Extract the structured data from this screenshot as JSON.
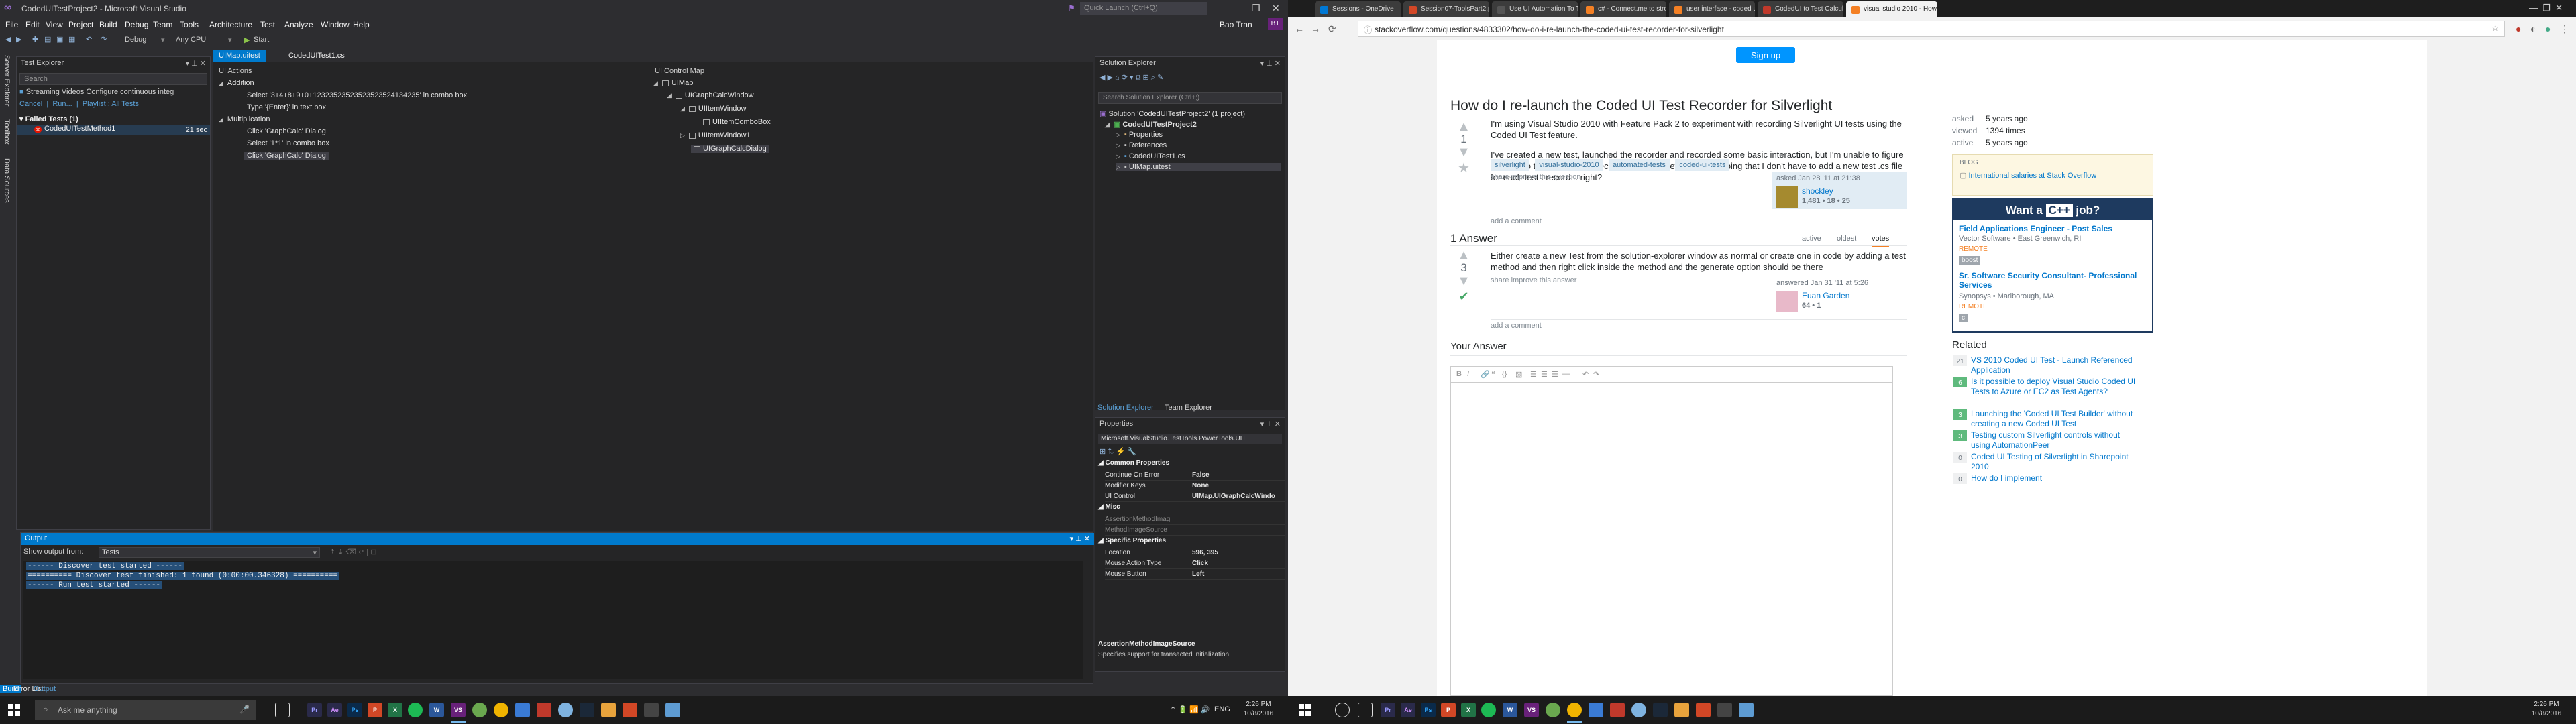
{
  "vs": {
    "title": "CodedUITestProject2 - Microsoft Visual Studio",
    "quick_launch": "Quick Launch (Ctrl+Q)",
    "user": "Bao Tran",
    "user_initials": "BT",
    "menu": [
      "File",
      "Edit",
      "View",
      "Project",
      "Build",
      "Debug",
      "Team",
      "Tools",
      "Architecture",
      "Test",
      "Analyze",
      "Window",
      "Help"
    ],
    "toolbar": {
      "config": "Debug",
      "platform": "Any CPU",
      "start": "Start"
    },
    "side_tabs": [
      "Server Explorer",
      "Toolbox",
      "Data Sources"
    ],
    "test_explorer": {
      "title": "Test Explorer",
      "search": "Search",
      "banner": "Streaming Videos Configure continuous integ",
      "links": [
        "Cancel",
        "Run...",
        "Playlist : All Tests"
      ],
      "group": "Failed Tests (1)",
      "test": "CodedUITestMethod1",
      "duration": "21 sec"
    },
    "doc_tabs": [
      "UIMap.uitest",
      "CodedUITest1.cs"
    ],
    "ui_actions": {
      "title": "UI Actions",
      "lines": [
        "Addition",
        "Select '3+4+8+9+0+12323523523523523524134235' in combo box",
        "Type '{Enter}' in text box",
        "Multiplication",
        "Click 'GraphCalc' Dialog",
        "Select '1*1' in combo box",
        "Click 'GraphCalc' Dialog"
      ]
    },
    "ui_control_map": {
      "title": "UI Control Map",
      "nodes": [
        "UIMap",
        "UIGraphCalcWindow",
        "UIItemWindow",
        "UIItemComboBox",
        "UIItemWindow1",
        "UIGraphCalcDialog"
      ]
    },
    "solution_explorer": {
      "title": "Solution Explorer",
      "search": "Search Solution Explorer (Ctrl+;)",
      "items": [
        "Solution 'CodedUITestProject2' (1 project)",
        "CodedUITestProject2",
        "Properties",
        "References",
        "CodedUITest1.cs",
        "UIMap.uitest"
      ],
      "tabs": [
        "Solution Explorer",
        "Team Explorer"
      ]
    },
    "properties": {
      "title": "Properties",
      "selector": "Microsoft.VisualStudio.TestTools.PowerTools.UIT",
      "cat1": "Common Properties",
      "rows1": [
        {
          "k": "Continue On Error",
          "v": "False"
        },
        {
          "k": "Modifier Keys",
          "v": "None"
        },
        {
          "k": "UI Control",
          "v": "UIMap.UIGraphCalcWindo"
        }
      ],
      "cat2": "Misc",
      "rows2": [
        {
          "k": "AssertionMethodImag",
          "v": ""
        },
        {
          "k": "MethodImageSource",
          "v": ""
        }
      ],
      "cat3": "Specific Properties",
      "rows3": [
        {
          "k": "Location",
          "v": "596, 395"
        },
        {
          "k": "Mouse Action Type",
          "v": "Click"
        },
        {
          "k": "Mouse Button",
          "v": "Left"
        }
      ],
      "desc_title": "AssertionMethodImageSource",
      "desc": "Specifies support for transacted initialization."
    },
    "output": {
      "title": "Output",
      "show_from_label": "Show output from:",
      "source": "Tests",
      "lines": [
        "------ Discover test started ------",
        "========== Discover test finished: 1 found (0:00:00.346328) ==========",
        "------ Run test started ------"
      ]
    },
    "status": [
      "Build",
      "Error List",
      "Output"
    ]
  },
  "left_taskbar": {
    "search": "Ask me anything",
    "time": "2:26 PM",
    "date": "10/8/2016",
    "lang": "ENG"
  },
  "chrome": {
    "tabs": [
      "Sessions - OneDrive",
      "Session07-ToolsPart2.pp",
      "Use UI Automation To T",
      "c# - Connect.me to stro",
      "user interface - coded u",
      "CodedUI to Test Calcula",
      "visual studio 2010 - How"
    ],
    "url": "stackoverflow.com/questions/4833302/how-do-i-re-launch-the-coded-ui-test-recorder-for-silverlight",
    "signup": "Sign up",
    "question": {
      "title": "How do I re-launch the Coded UI Test Recorder for Silverlight",
      "votes": "1",
      "p1": "I'm using Visual Studio 2010 with Feature Pack 2 to experiment with recording Silverlight UI tests using the Coded UI Test feature.",
      "p2": "I've created a new test, launched the recorder and recorded some basic interaction, but I'm unable to figure out how to to re-launch the recorder to add a new test. I'm hoping that I don't have to add a new test .cs file for each test I record... right?",
      "tags": [
        "silverlight",
        "visual-studio-2010",
        "automated-tests",
        "coded-ui-tests"
      ],
      "actions": "share  improve this question",
      "asked": "asked Jan 28 '11 at 21:38",
      "user": "shockley",
      "rep": "1,481 • 18 • 25",
      "comment": "add a comment"
    },
    "answers_header": "1 Answer",
    "sort": [
      "active",
      "oldest",
      "votes"
    ],
    "answer": {
      "votes": "3",
      "text": "Either create a new Test from the solution-explorer window as normal or create one in code by adding a test method and then right click inside the method and the generate option should be there",
      "actions": "share  improve this answer",
      "answered": "answered Jan 31 '11 at 5:26",
      "user": "Euan Garden",
      "rep": "64 • 1",
      "comment": "add a comment"
    },
    "your_answer": "Your Answer",
    "meta": [
      {
        "k": "asked",
        "v": "5 years ago"
      },
      {
        "k": "viewed",
        "v": "1394 times"
      },
      {
        "k": "active",
        "v": "5 years ago"
      }
    ],
    "blog": {
      "title": "BLOG",
      "item": "International salaries at Stack Overflow"
    },
    "job": {
      "head": "Want a",
      "head_tag": "C++",
      "head_end": "job?",
      "jobs": [
        {
          "t": "Field Applications Engineer - Post Sales",
          "co": "Vector Software  •  East Greenwich, RI",
          "r": "REMOTE",
          "tag": "boost"
        },
        {
          "t": "Sr. Software Security Consultant- Professional Services",
          "co": "Synopsys  •  Marlborough, MA",
          "r": "REMOTE",
          "tag": "c"
        }
      ]
    },
    "related_title": "Related",
    "related": [
      {
        "c": "21",
        "t": "VS 2010 Coded UI Test - Launch Referenced Application",
        "g": false
      },
      {
        "c": "6",
        "t": "Is it possible to deploy Visual Studio Coded UI Tests to Azure or EC2 as Test Agents?",
        "g": true
      },
      {
        "c": "3",
        "t": "Launching the 'Coded UI Test Builder' without creating a new Coded UI Test",
        "g": true
      },
      {
        "c": "3",
        "t": "Testing custom Silverlight controls without using AutomationPeer",
        "g": true
      },
      {
        "c": "0",
        "t": "Coded UI Testing of Silverlight in Sharepoint 2010",
        "g": false
      },
      {
        "c": "0",
        "t": "How do I implement",
        "g": false
      }
    ]
  },
  "right_taskbar": {
    "time": "2:26 PM",
    "date": "10/8/2016"
  }
}
